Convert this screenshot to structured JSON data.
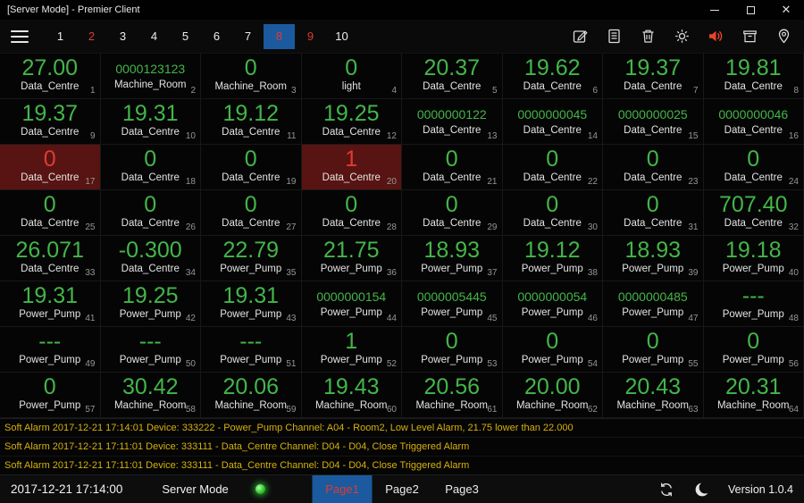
{
  "window": {
    "title": "[Server Mode] - Premier Client",
    "controls": [
      "minimize",
      "maximize",
      "close"
    ]
  },
  "toolbar": {
    "menu_icon": "hamburger-icon",
    "pages": [
      {
        "label": "1"
      },
      {
        "label": "2",
        "alarm": true
      },
      {
        "label": "3"
      },
      {
        "label": "4"
      },
      {
        "label": "5"
      },
      {
        "label": "6"
      },
      {
        "label": "7"
      },
      {
        "label": "8",
        "alarm": true,
        "selected": true
      },
      {
        "label": "9",
        "alarm": true
      },
      {
        "label": "10"
      }
    ],
    "icons": [
      "edit-icon",
      "report-icon",
      "trash-icon",
      "settings-gear-icon",
      "speaker-sound-icon",
      "archive-bin-icon",
      "location-pin-icon"
    ]
  },
  "grid": {
    "cells": [
      {
        "value": "27.00",
        "label": "Data_Centre",
        "index": 1
      },
      {
        "value": "0000123123",
        "label": "Machine_Room",
        "index": 2
      },
      {
        "value": "0",
        "label": "Machine_Room",
        "index": 3
      },
      {
        "value": "0",
        "label": "light",
        "index": 4
      },
      {
        "value": "20.37",
        "label": "Data_Centre",
        "index": 5
      },
      {
        "value": "19.62",
        "label": "Data_Centre",
        "index": 6
      },
      {
        "value": "19.37",
        "label": "Data_Centre",
        "index": 7
      },
      {
        "value": "19.81",
        "label": "Data_Centre",
        "index": 8
      },
      {
        "value": "19.37",
        "label": "Data_Centre",
        "index": 9
      },
      {
        "value": "19.31",
        "label": "Data_Centre",
        "index": 10
      },
      {
        "value": "19.12",
        "label": "Data_Centre",
        "index": 11
      },
      {
        "value": "19.25",
        "label": "Data_Centre",
        "index": 12
      },
      {
        "value": "0000000122",
        "label": "Data_Centre",
        "index": 13
      },
      {
        "value": "0000000045",
        "label": "Data_Centre",
        "index": 14
      },
      {
        "value": "0000000025",
        "label": "Data_Centre",
        "index": 15
      },
      {
        "value": "0000000046",
        "label": "Data_Centre",
        "index": 16
      },
      {
        "value": "0",
        "label": "Data_Centre",
        "index": 17,
        "alarm": true
      },
      {
        "value": "0",
        "label": "Data_Centre",
        "index": 18
      },
      {
        "value": "0",
        "label": "Data_Centre",
        "index": 19
      },
      {
        "value": "1",
        "label": "Data_Centre",
        "index": 20,
        "alarm": true
      },
      {
        "value": "0",
        "label": "Data_Centre",
        "index": 21
      },
      {
        "value": "0",
        "label": "Data_Centre",
        "index": 22
      },
      {
        "value": "0",
        "label": "Data_Centre",
        "index": 23
      },
      {
        "value": "0",
        "label": "Data_Centre",
        "index": 24
      },
      {
        "value": "0",
        "label": "Data_Centre",
        "index": 25
      },
      {
        "value": "0",
        "label": "Data_Centre",
        "index": 26
      },
      {
        "value": "0",
        "label": "Data_Centre",
        "index": 27
      },
      {
        "value": "0",
        "label": "Data_Centre",
        "index": 28
      },
      {
        "value": "0",
        "label": "Data_Centre",
        "index": 29
      },
      {
        "value": "0",
        "label": "Data_Centre",
        "index": 30
      },
      {
        "value": "0",
        "label": "Data_Centre",
        "index": 31
      },
      {
        "value": "707.40",
        "label": "Data_Centre",
        "index": 32
      },
      {
        "value": "26.071",
        "label": "Data_Centre",
        "index": 33
      },
      {
        "value": "-0.300",
        "label": "Data_Centre",
        "index": 34
      },
      {
        "value": "22.79",
        "label": "Power_Pump",
        "index": 35
      },
      {
        "value": "21.75",
        "label": "Power_Pump",
        "index": 36
      },
      {
        "value": "18.93",
        "label": "Power_Pump",
        "index": 37
      },
      {
        "value": "19.12",
        "label": "Power_Pump",
        "index": 38
      },
      {
        "value": "18.93",
        "label": "Power_Pump",
        "index": 39
      },
      {
        "value": "19.18",
        "label": "Power_Pump",
        "index": 40
      },
      {
        "value": "19.31",
        "label": "Power_Pump",
        "index": 41
      },
      {
        "value": "19.25",
        "label": "Power_Pump",
        "index": 42
      },
      {
        "value": "19.31",
        "label": "Power_Pump",
        "index": 43
      },
      {
        "value": "0000000154",
        "label": "Power_Pump",
        "index": 44
      },
      {
        "value": "0000005445",
        "label": "Power_Pump",
        "index": 45
      },
      {
        "value": "0000000054",
        "label": "Power_Pump",
        "index": 46
      },
      {
        "value": "0000000485",
        "label": "Power_Pump",
        "index": 47
      },
      {
        "value": "---",
        "label": "Power_Pump",
        "index": 48
      },
      {
        "value": "---",
        "label": "Power_Pump",
        "index": 49
      },
      {
        "value": "---",
        "label": "Power_Pump",
        "index": 50
      },
      {
        "value": "---",
        "label": "Power_Pump",
        "index": 51
      },
      {
        "value": "1",
        "label": "Power_Pump",
        "index": 52
      },
      {
        "value": "0",
        "label": "Power_Pump",
        "index": 53
      },
      {
        "value": "0",
        "label": "Power_Pump",
        "index": 54
      },
      {
        "value": "0",
        "label": "Power_Pump",
        "index": 55
      },
      {
        "value": "0",
        "label": "Power_Pump",
        "index": 56
      },
      {
        "value": "0",
        "label": "Power_Pump",
        "index": 57
      },
      {
        "value": "30.42",
        "label": "Machine_Room",
        "index": 58
      },
      {
        "value": "20.06",
        "label": "Machine_Room",
        "index": 59
      },
      {
        "value": "19.43",
        "label": "Machine_Room",
        "index": 60
      },
      {
        "value": "20.56",
        "label": "Machine_Room",
        "index": 61
      },
      {
        "value": "20.00",
        "label": "Machine_Room",
        "index": 62
      },
      {
        "value": "20.43",
        "label": "Machine_Room",
        "index": 63
      },
      {
        "value": "20.31",
        "label": "Machine_Room",
        "index": 64
      }
    ]
  },
  "alarms": [
    "Soft Alarm 2017-12-21 17:14:01 Device: 333222 - Power_Pump Channel: A04 - Room2, Low Level Alarm, 21.75 lower than 22.000",
    "Soft Alarm 2017-12-21 17:11:01 Device: 333111 - Data_Centre Channel: D04 - D04, Close Triggered Alarm",
    "Soft Alarm 2017-12-21 17:11:01 Device: 333111 - Data_Centre Channel: D04 - D04, Close Triggered Alarm"
  ],
  "statusbar": {
    "timestamp": "2017-12-21 17:14:00",
    "mode_label": "Server Mode",
    "indicator": "green",
    "tabs": [
      {
        "label": "Page1",
        "active": true,
        "alarm": true
      },
      {
        "label": "Page2"
      },
      {
        "label": "Page3"
      }
    ],
    "icons": [
      "sync-icon",
      "night-mode-moon-icon"
    ],
    "version": "Version 1.0.4"
  },
  "colors": {
    "value_green": "#43b649",
    "value_red": "#e03a35",
    "alarm_cell_bg": "#581412",
    "alarm_text": "#d6b10c",
    "tab_active_bg": "#1b5a9e",
    "indicator_green": "#25c422",
    "speaker_red": "#e8432c"
  }
}
